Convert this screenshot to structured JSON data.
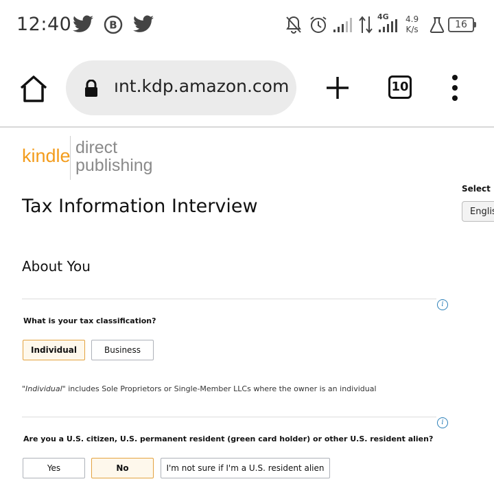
{
  "status_bar": {
    "time": "12:40",
    "net_speed_value": "4.9",
    "net_speed_unit": "K/s",
    "network_type": "4G",
    "battery": "16",
    "icons": [
      "twitter-icon",
      "b-circle-icon",
      "twitter-icon",
      "bell-off-icon",
      "alarm-icon",
      "signal-icon",
      "data-arrows-icon",
      "signal-4g-icon",
      "flask-icon",
      "battery-icon"
    ]
  },
  "browser": {
    "url": "ınt.kdp.amazon.com",
    "tab_count": "10",
    "icons": [
      "home-icon",
      "lock-icon",
      "plus-icon",
      "tabs-icon",
      "more-vert-icon"
    ]
  },
  "logo": {
    "kindle": "kindle",
    "direct": "direct",
    "publishing": "publishing",
    "kindle_color": "#f39c1c"
  },
  "language": {
    "label": "Select La",
    "selected": "Englis"
  },
  "page": {
    "title": "Tax Information Interview",
    "section_title": "About You"
  },
  "q1": {
    "question": "What is your tax classification?",
    "options": [
      "Individual",
      "Business"
    ],
    "selected": "Individual",
    "note_quoted": "\"Individual\"",
    "note_rest": " includes Sole Proprietors or Single-Member LLCs where the owner is an individual"
  },
  "q2": {
    "question": "Are you a U.S. citizen, U.S. permanent resident (green card holder) or other U.S. resident alien?",
    "options": [
      "Yes",
      "No",
      "I'm not sure if I'm a U.S. resident alien"
    ],
    "selected": "No"
  },
  "colors": {
    "selected_bg": "#fef8ec",
    "selected_border": "#e3a23e",
    "info_icon": "#2b7fb8"
  }
}
